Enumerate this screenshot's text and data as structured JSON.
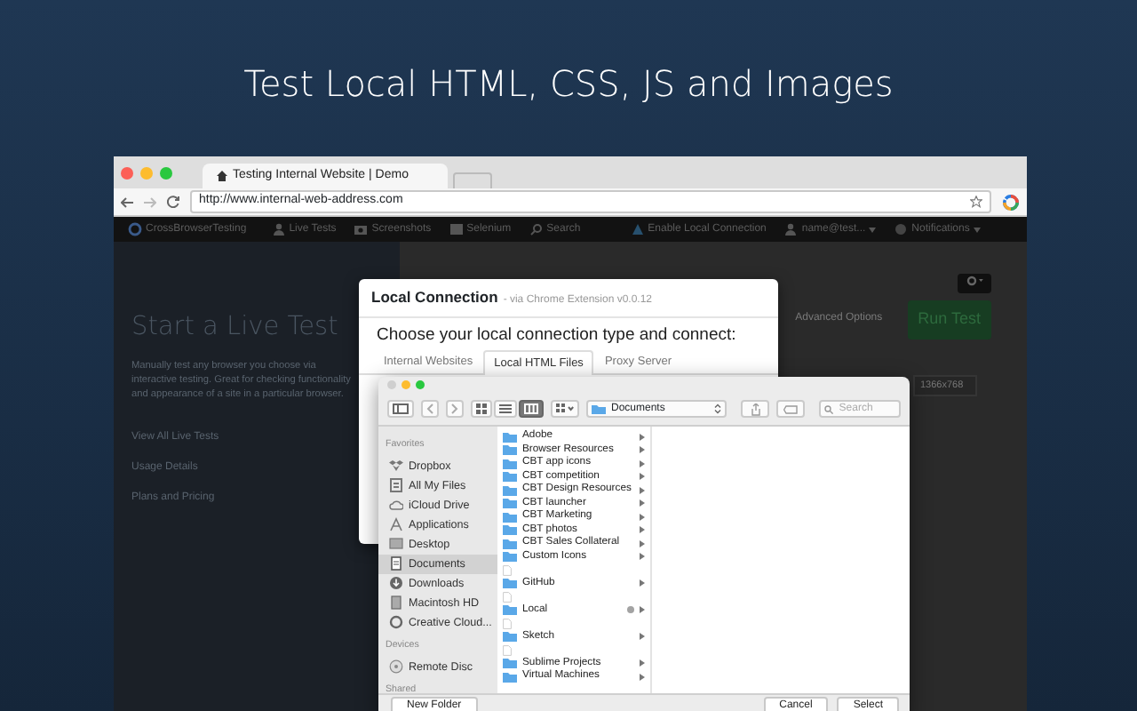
{
  "headline": "Test Local HTML, CSS, JS and Images",
  "browser": {
    "tabs": [
      {
        "title": "Testing Internal Website | Demo",
        "selected": true
      }
    ],
    "url": "http://www.internal-web-address.com"
  },
  "app": {
    "nav": [
      {
        "kind": "brand",
        "label": "CrossBrowserTesting"
      },
      {
        "kind": "user",
        "label": "Live Tests"
      },
      {
        "kind": "camera",
        "label": "Screenshots"
      },
      {
        "kind": "grid",
        "label": "Selenium"
      },
      {
        "kind": "search",
        "label": "Search"
      },
      {
        "kind": "local",
        "label": "Enable Local Connection"
      },
      {
        "kind": "user",
        "label": "name@test...",
        "dropdown": true
      },
      {
        "kind": "globe",
        "label": "Notifications",
        "dropdown": true
      }
    ],
    "title": "Start a Live Test",
    "description": "Manually test any browser you choose via interactive testing. Great for checking functionality and appearance of a site in a particular browser.",
    "links": [
      "View All Live Tests",
      "Usage Details",
      "Plans and Pricing"
    ],
    "advanced_options": "Advanced Options",
    "run_button": "Run Test",
    "resolution": "1366x768"
  },
  "local_connection": {
    "title": "Local Connection",
    "subtitle": "- via Chrome Extension v0.0.12",
    "prompt": "Choose your local connection type and connect:",
    "tabs": [
      {
        "label": "Internal Websites",
        "selected": false
      },
      {
        "label": "Local HTML Files",
        "selected": true
      },
      {
        "label": "Proxy Server",
        "selected": false
      }
    ]
  },
  "file_dialog": {
    "path": "Documents",
    "search_placeholder": "Search",
    "sidebar": [
      {
        "title": "Favorites",
        "items": [
          {
            "kind": "dropbox",
            "label": "Dropbox",
            "selected": false
          },
          {
            "kind": "files",
            "label": "All My Files",
            "selected": false
          },
          {
            "kind": "cloud",
            "label": "iCloud Drive",
            "selected": false
          },
          {
            "kind": "apps",
            "label": "Applications",
            "selected": false
          },
          {
            "kind": "desktop",
            "label": "Desktop",
            "selected": false
          },
          {
            "kind": "documents",
            "label": "Documents",
            "selected": true
          },
          {
            "kind": "downloads",
            "label": "Downloads",
            "selected": false
          },
          {
            "kind": "disk",
            "label": "Macintosh HD",
            "selected": false
          },
          {
            "kind": "creative",
            "label": "Creative Cloud...",
            "selected": false
          }
        ]
      },
      {
        "title": "Devices",
        "items": [
          {
            "kind": "disc",
            "label": "Remote Disc",
            "selected": false
          }
        ]
      },
      {
        "title": "Shared"
      }
    ],
    "items": [
      {
        "kind": "folder",
        "name": "Adobe"
      },
      {
        "kind": "folder",
        "name": "Browser Resources"
      },
      {
        "kind": "folder",
        "name": "CBT app icons"
      },
      {
        "kind": "folder",
        "name": "CBT competition"
      },
      {
        "kind": "folder",
        "name": "CBT Design Resources"
      },
      {
        "kind": "folder",
        "name": "CBT launcher"
      },
      {
        "kind": "folder",
        "name": "CBT Marketing"
      },
      {
        "kind": "folder",
        "name": "CBT photos"
      },
      {
        "kind": "folder",
        "name": "CBT Sales Collateral"
      },
      {
        "kind": "folder",
        "name": "Custom Icons"
      },
      {
        "kind": "file"
      },
      {
        "kind": "folder",
        "name": "GitHub"
      },
      {
        "kind": "file"
      },
      {
        "kind": "folder",
        "name": "Local",
        "color": "#a3a3a3"
      },
      {
        "kind": "file"
      },
      {
        "kind": "folder",
        "name": "Sketch"
      },
      {
        "kind": "file"
      },
      {
        "kind": "folder",
        "name": "Sublime Projects"
      },
      {
        "kind": "folder",
        "name": "Virtual Machines"
      }
    ],
    "new_folder": "New Folder",
    "cancel": "Cancel",
    "select": "Select"
  }
}
